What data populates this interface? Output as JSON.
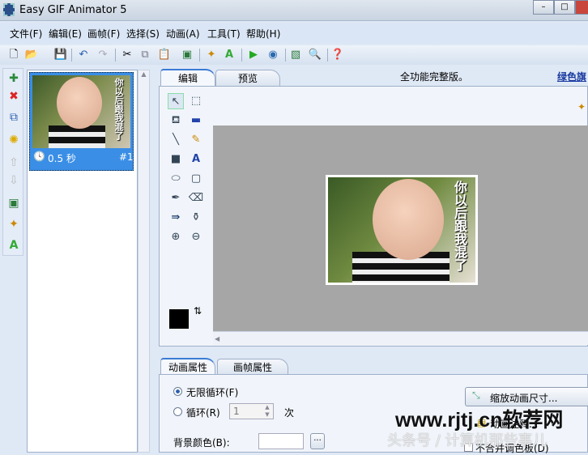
{
  "window": {
    "title": "Easy GIF Animator 5",
    "min": "–",
    "max": "□"
  },
  "menu": [
    "文件(F)",
    "编辑(E)",
    "画帧(F)",
    "选择(S)",
    "动画(A)",
    "工具(T)",
    "帮助(H)"
  ],
  "frames": [
    {
      "duration": "0.5 秒",
      "index": "#1",
      "caption": "你以后跟我混了"
    }
  ],
  "tabs": {
    "edit": "编辑",
    "preview": "预览"
  },
  "banner": {
    "notice": "全功能完整版。",
    "link": "绿色旗"
  },
  "bottom_tabs": {
    "animation": "动画属性",
    "frame": "画帧属性"
  },
  "props": {
    "infinite_loop": "无限循环(F)",
    "loop": "循环(R)",
    "loop_count": "1",
    "times": "次",
    "bg_color": "背景颜色(B):",
    "browse": "...",
    "resize": "缩放动画尺寸...",
    "comment": "动画注释...",
    "no_merge": "不合并调色板(D)"
  },
  "watermark": {
    "site": "www.rjtj.cn软荐网",
    "source": "头条号 / 计算机那些事儿"
  }
}
